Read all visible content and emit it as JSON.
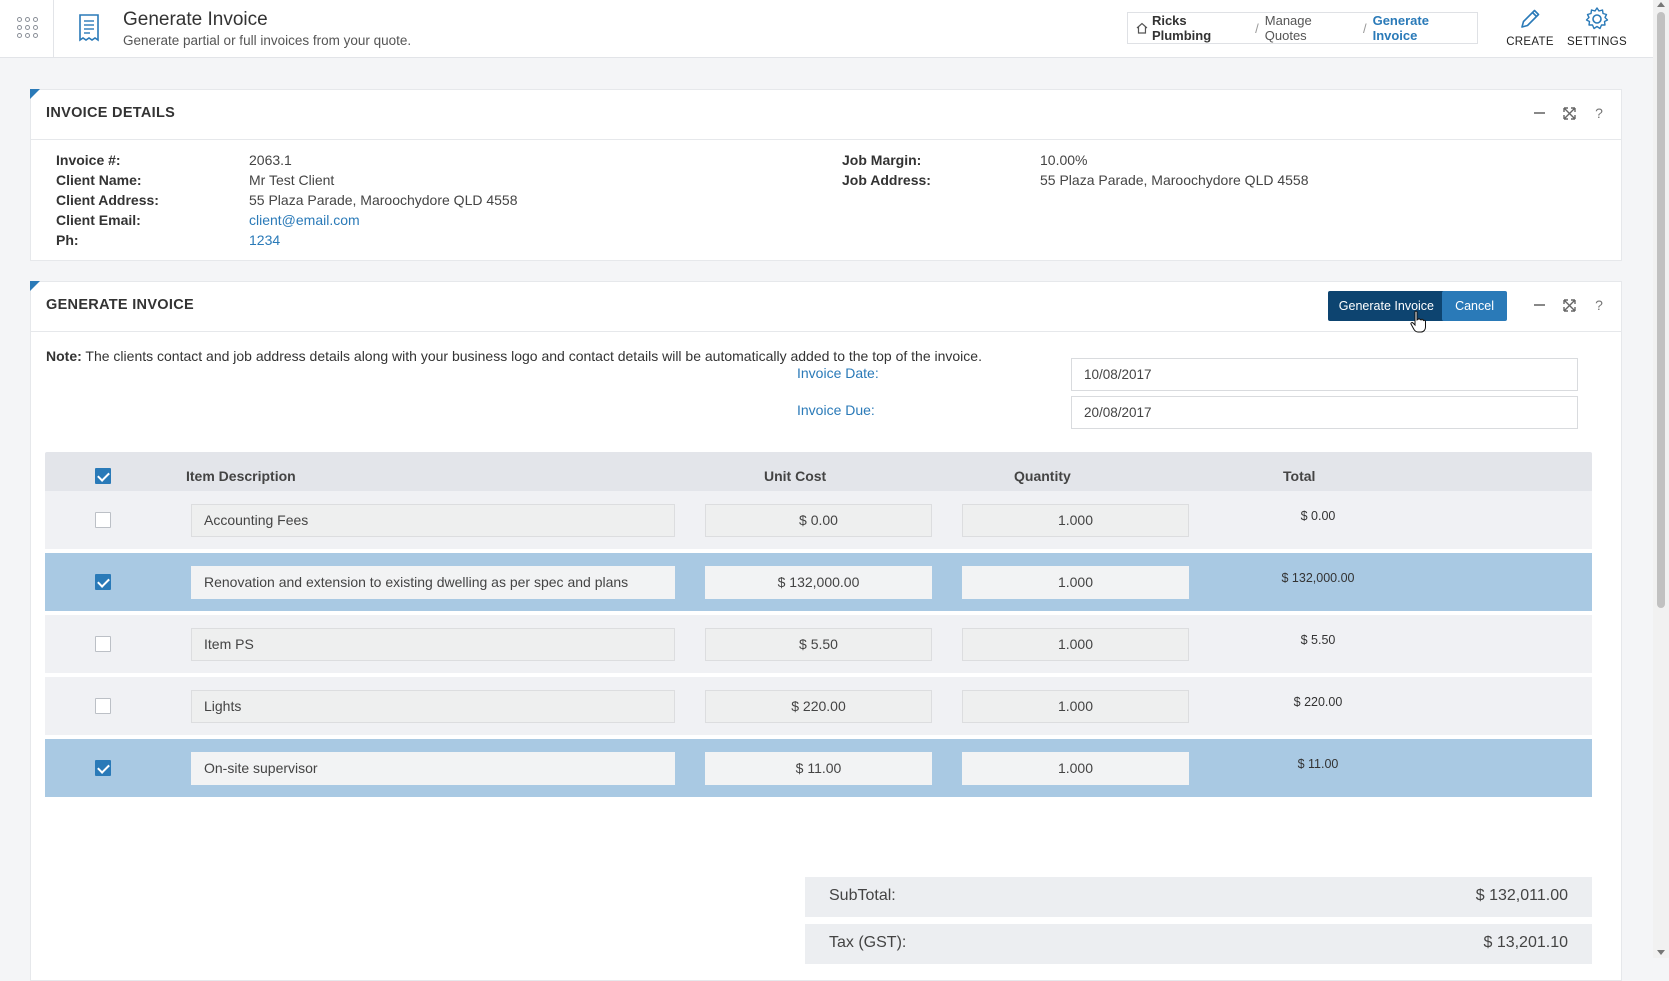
{
  "header": {
    "title": "Generate Invoice",
    "subtitle": "Generate partial or full invoices from your quote."
  },
  "breadcrumb": {
    "home": "Ricks Plumbing",
    "sep": "/",
    "middle": "Manage Quotes",
    "active": "Generate Invoice"
  },
  "actions": {
    "create": "CREATE",
    "settings": "SETTINGS"
  },
  "invoice_details": {
    "title": "INVOICE DETAILS",
    "invoice_no_label": "Invoice #:",
    "invoice_no": "2063.1",
    "client_name_label": "Client Name:",
    "client_name": "Mr Test Client",
    "client_address_label": "Client Address:",
    "client_address": "55 Plaza Parade, Maroochydore QLD 4558",
    "client_email_label": "Client Email:",
    "client_email": "client@email.com",
    "ph_label": "Ph:",
    "ph": "1234",
    "job_margin_label": "Job Margin:",
    "job_margin": "10.00%",
    "job_address_label": "Job Address:",
    "job_address": "55 Plaza Parade, Maroochydore QLD 4558"
  },
  "generate": {
    "title": "GENERATE INVOICE",
    "generate_btn": "Generate Invoice",
    "cancel_btn": "Cancel",
    "note_label": "Note:",
    "note_text": " The clients contact and job address details along with your business logo and contact details will be automatically added to the top of the invoice.",
    "invoice_date_label": "Invoice Date:",
    "invoice_date": "10/08/2017",
    "invoice_due_label": "Invoice Due:",
    "invoice_due": "20/08/2017"
  },
  "table": {
    "headers": {
      "description": "Item Description",
      "unit_cost": "Unit Cost",
      "quantity": "Quantity",
      "total": "Total"
    },
    "header_checked": true,
    "rows": [
      {
        "checked": false,
        "description": "Accounting Fees",
        "unit_cost": "$ 0.00",
        "quantity": "1.000",
        "total": "$ 0.00"
      },
      {
        "checked": true,
        "description": "Renovation and extension to existing dwelling as per spec and plans",
        "unit_cost": "$ 132,000.00",
        "quantity": "1.000",
        "total": "$ 132,000.00"
      },
      {
        "checked": false,
        "description": "Item PS",
        "unit_cost": "$ 5.50",
        "quantity": "1.000",
        "total": "$ 5.50"
      },
      {
        "checked": false,
        "description": "Lights",
        "unit_cost": "$ 220.00",
        "quantity": "1.000",
        "total": "$ 220.00"
      },
      {
        "checked": true,
        "description": "On-site supervisor",
        "unit_cost": "$ 11.00",
        "quantity": "1.000",
        "total": "$ 11.00"
      }
    ]
  },
  "summary": {
    "subtotal_label": "SubTotal:",
    "subtotal": "$ 132,011.00",
    "tax_label": "Tax (GST):",
    "tax": "$ 13,201.10"
  },
  "colors": {
    "accent": "#2a7ab8",
    "primary_button": "#0d4470",
    "selected_row": "#a9c9e3"
  }
}
